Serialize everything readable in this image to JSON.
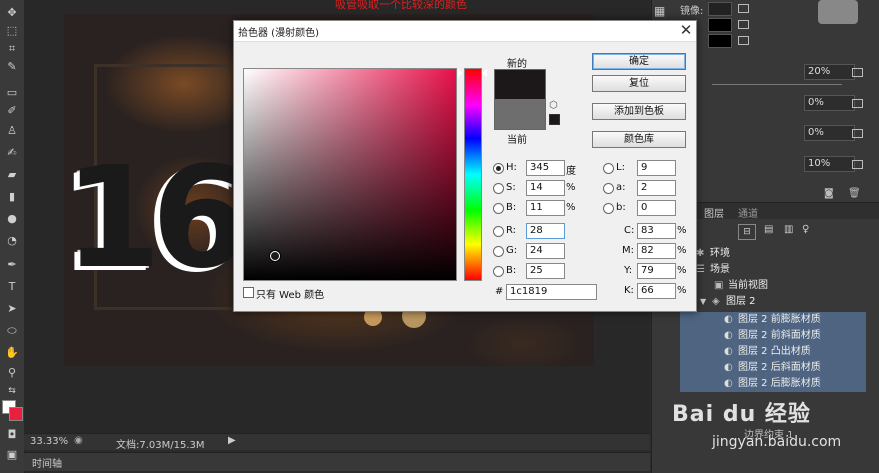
{
  "canvas": {
    "caption": "吸管吸取一个比较深的颜色",
    "zoom": "33.33%",
    "doc_info": "文档:7.03M/15.3M",
    "timeline_label": "时间轴"
  },
  "dialog": {
    "title": "拾色器 (漫射颜色)",
    "new_label": "新的",
    "current_label": "当前",
    "buttons": {
      "ok": "确定",
      "reset": "复位",
      "add_swatch": "添加到色板",
      "color_lib": "颜色库"
    },
    "fields": {
      "H": {
        "label": "H:",
        "value": "345",
        "unit": "度"
      },
      "S": {
        "label": "S:",
        "value": "14",
        "unit": "%"
      },
      "Bv": {
        "label": "B:",
        "value": "11",
        "unit": "%"
      },
      "R": {
        "label": "R:",
        "value": "28"
      },
      "G": {
        "label": "G:",
        "value": "24"
      },
      "Bc": {
        "label": "B:",
        "value": "25"
      },
      "L": {
        "label": "L:",
        "value": "9"
      },
      "a": {
        "label": "a:",
        "value": "2"
      },
      "b": {
        "label": "b:",
        "value": "0"
      },
      "C": {
        "label": "C:",
        "value": "83",
        "unit": "%"
      },
      "M": {
        "label": "M:",
        "value": "82",
        "unit": "%"
      },
      "Y": {
        "label": "Y:",
        "value": "79",
        "unit": "%"
      },
      "K": {
        "label": "K:",
        "value": "66",
        "unit": "%"
      }
    },
    "web_only_label": "只有 Web 颜色",
    "hex_label": "#",
    "hex_value": "1c1819",
    "new_color": "#1c1819",
    "current_color": "#6e6e6e"
  },
  "right_panel": {
    "top_labels": [
      "镜像:"
    ],
    "percent_values": [
      "20%",
      "0%",
      "0%",
      "10%"
    ],
    "tabs": [
      "图层",
      "通道"
    ],
    "tree": [
      {
        "label": "环境",
        "selected": false
      },
      {
        "label": "场景",
        "selected": false
      },
      {
        "label": "当前视图",
        "selected": false
      },
      {
        "label": "图层 2",
        "selected": false
      },
      {
        "label": "图层 2 前膨胀材质",
        "selected": true
      },
      {
        "label": "图层 2 前斜面材质",
        "selected": true
      },
      {
        "label": "图层 2 凸出材质",
        "selected": true
      },
      {
        "label": "图层 2 后斜面材质",
        "selected": true
      },
      {
        "label": "图层 2 后膨胀材质",
        "selected": true
      },
      {
        "label": "边界约束 1",
        "selected": false
      }
    ]
  },
  "watermark": {
    "logo": "Bai du 经验",
    "url": "jingyan.baidu.com"
  },
  "colors": {
    "foreground": "#ffffff",
    "background": "#e8203c",
    "selection": "#4e6481"
  }
}
